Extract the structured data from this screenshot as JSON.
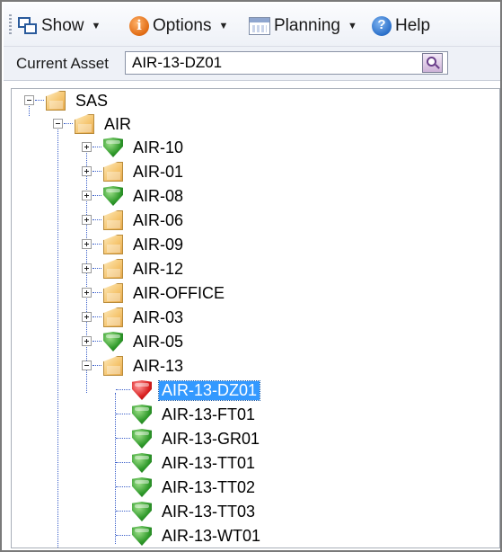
{
  "toolbar": {
    "show_label": "Show",
    "options_label": "Options",
    "planning_label": "Planning",
    "help_label": "Help",
    "dropdown_caret": "▼"
  },
  "asset": {
    "label": "Current Asset",
    "value": "AIR-13-DZ01"
  },
  "tree": {
    "root": "SAS",
    "group": "AIR",
    "children": [
      {
        "label": "AIR-10",
        "icon": "shield-green"
      },
      {
        "label": "AIR-01",
        "icon": "folder"
      },
      {
        "label": "AIR-08",
        "icon": "shield-green"
      },
      {
        "label": "AIR-06",
        "icon": "folder"
      },
      {
        "label": "AIR-09",
        "icon": "folder"
      },
      {
        "label": "AIR-12",
        "icon": "folder"
      },
      {
        "label": "AIR-OFFICE",
        "icon": "folder"
      },
      {
        "label": "AIR-03",
        "icon": "folder"
      },
      {
        "label": "AIR-05",
        "icon": "shield-green"
      },
      {
        "label": "AIR-13",
        "icon": "folder"
      }
    ],
    "air13_children": [
      {
        "label": "AIR-13-DZ01",
        "icon": "shield-red",
        "selected": true
      },
      {
        "label": "AIR-13-FT01",
        "icon": "shield-green"
      },
      {
        "label": "AIR-13-GR01",
        "icon": "shield-green"
      },
      {
        "label": "AIR-13-TT01",
        "icon": "shield-green"
      },
      {
        "label": "AIR-13-TT02",
        "icon": "shield-green"
      },
      {
        "label": "AIR-13-TT03",
        "icon": "shield-green"
      },
      {
        "label": "AIR-13-WT01",
        "icon": "shield-green"
      }
    ]
  },
  "colors": {
    "selection": "#3399ff",
    "tree_lines": "#3a5fc9",
    "shield_green": "#2f9a2a",
    "shield_red": "#d91f1f"
  }
}
